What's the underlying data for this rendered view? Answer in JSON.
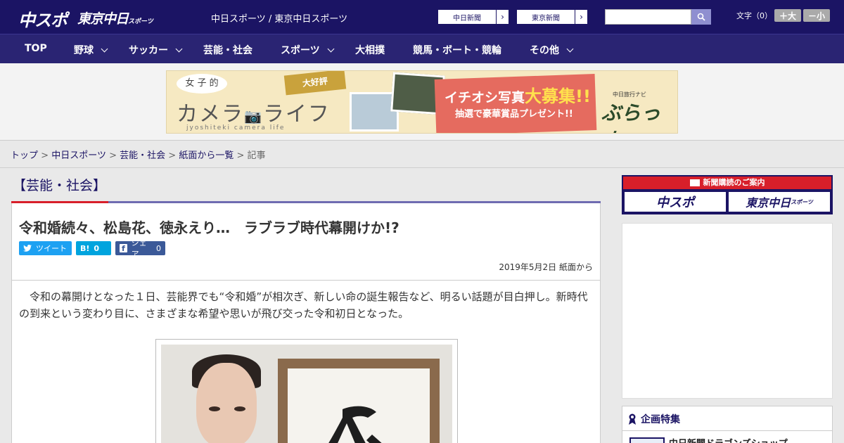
{
  "header": {
    "logo_main": "中スポ",
    "logo_sub": "東京中日",
    "logo_sub_small": "スポーツ",
    "site_links": "中日スポーツ / 東京中日スポーツ",
    "pill_chunichi": "中日新聞",
    "pill_tokyo": "東京新聞",
    "font_size_label": "文字（0）",
    "font_larger": "＋大",
    "font_smaller": "－小"
  },
  "nav": {
    "items": [
      {
        "label": "TOP"
      },
      {
        "label": "野球"
      },
      {
        "label": "サッカー"
      },
      {
        "label": "芸能・社会"
      },
      {
        "label": "スポーツ"
      },
      {
        "label": "大相撲"
      },
      {
        "label": "競馬・ボート・競輪"
      },
      {
        "label": "その他"
      }
    ]
  },
  "banner": {
    "bubble": "女 子 的",
    "title": "カメラ",
    "title2": "ライフ",
    "subtitle": "jyoshiteki camera life",
    "tag": "大好評",
    "headline_pre": "イチオシ写真",
    "headline_em": "大募集!!",
    "prize": "抽選で豪華賞品プレゼント!!",
    "brand_small": "中日旅行ナビ",
    "brand": "ぶらっ人"
  },
  "breadcrumb": {
    "items": [
      "トップ",
      "中日スポーツ",
      "芸能・社会",
      "紙面から一覧"
    ],
    "current": "記事",
    "separator": ">"
  },
  "article": {
    "section": "【芸能・社会】",
    "headline": "令和婚続々、松島花、徳永えり…　ラブラブ時代幕開けか!?",
    "tweet_label": "ツイート",
    "hatena_label": "B!",
    "hatena_count": "0",
    "facebook_label": "シェア",
    "facebook_count": "0",
    "date": "2019年5月2日 紙面から",
    "body": "令和の幕開けとなった１日、芸能界でも“令和婚”が相次ぎ、新しい命の誕生報告など、明るい話題が目白押し。新時代の到来という変わり目に、さまざまな希望や思いが飛び交った令和初日となった。"
  },
  "sidebar": {
    "subscribe_head": "新聞購読のご案内",
    "subscribe_logo1": "中スポ",
    "subscribe_logo2": "東京中日",
    "subscribe_logo2_small": "スポーツ",
    "feature_head": "企画特集",
    "feature_item": "中日新聞ドラゴンズショップ"
  },
  "colors": {
    "brand_navy": "#1b1464",
    "accent_red": "#d81f2a",
    "twitter": "#1da1f2",
    "hatena": "#00a4de",
    "facebook": "#3b5998"
  }
}
